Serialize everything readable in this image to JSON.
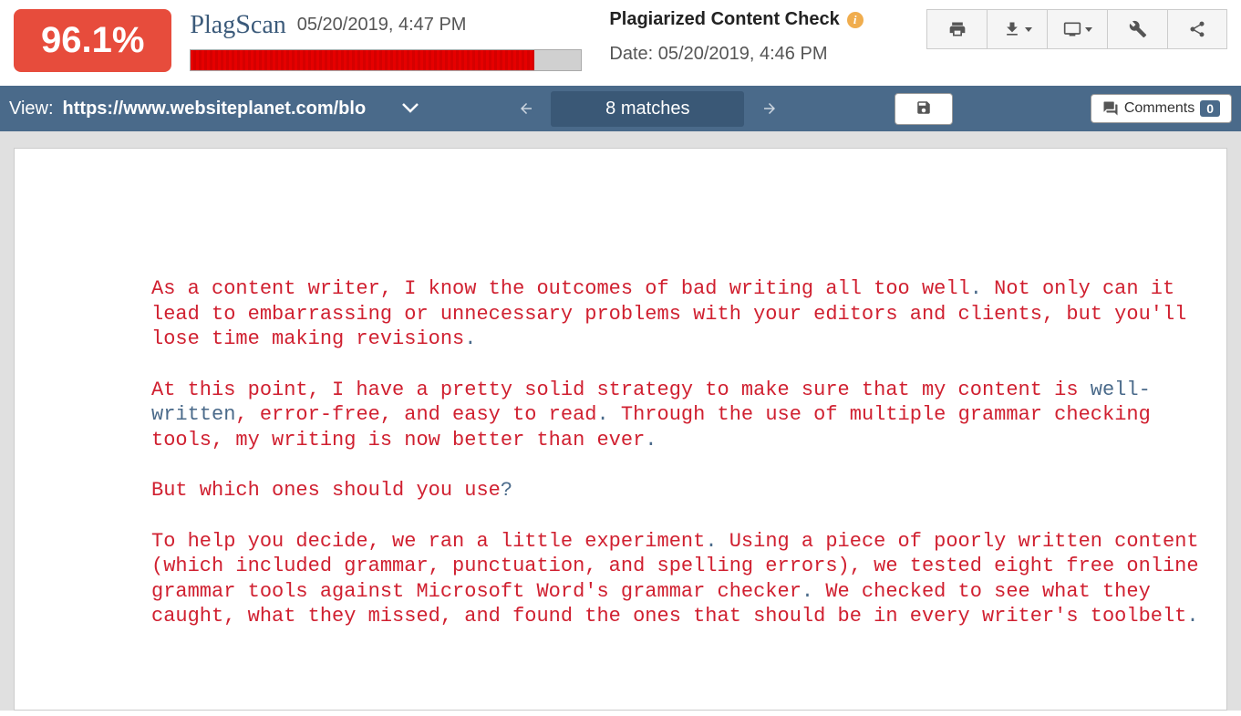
{
  "header": {
    "percentage": "96.1%",
    "logo": "PlagScan",
    "timestamp": "05/20/2019, 4:47 PM",
    "progress_percent": 88,
    "title": "Plagiarized Content Check",
    "date_label": "Date: 05/20/2019, 4:46 PM"
  },
  "bluebar": {
    "view_label": "View:",
    "url": "https://www.websiteplanet.com/blo",
    "matches": "8 matches",
    "comments_label": "Comments",
    "comments_count": "0"
  },
  "document": {
    "p1_a": "As a content writer, I know the outcomes of bad writing all too well",
    "p1_b": " Not only can it lead to embarrassing or unnecessary problems with your editors and clients, but you'll lose time making revisions",
    "p2_a": "At this point, I have a pretty solid strategy to make sure that my content is ",
    "p2_alt": "well-written",
    "p2_b": ", error-free, and easy to read",
    "p2_c": " Through the use of multiple grammar checking tools, my writing is now better than ever",
    "p3_a": "But which ones should you use",
    "p4_a": "To help you decide, we ran a little experiment",
    "p4_b": " Using a piece of poorly written content (which included grammar, punctuation, and spelling errors), we tested eight free online grammar tools against Microsoft Word's grammar checker",
    "p4_c": " We checked to see what they caught, what they missed, and found the ones that should be in every writer's toolbelt"
  }
}
